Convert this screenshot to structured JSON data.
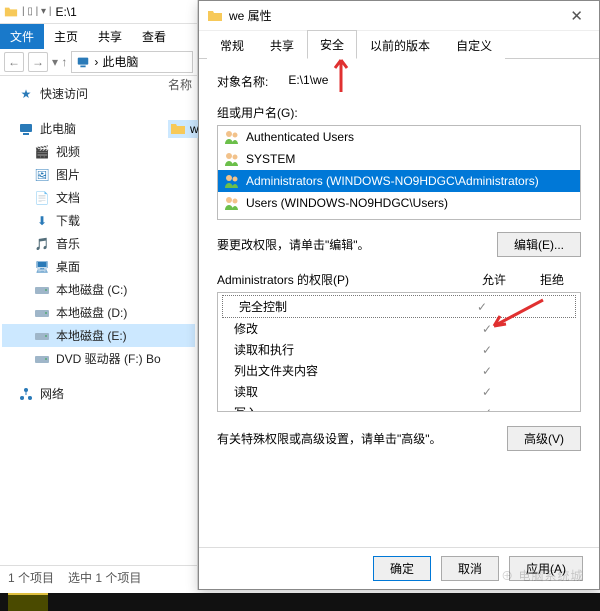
{
  "explorer": {
    "title_path": "E:\\1",
    "ribbon": {
      "file": "文件",
      "home": "主页",
      "share": "共享",
      "view": "查看"
    },
    "breadcrumb": "此电脑",
    "content_header": "名称",
    "file_row": "we",
    "tree": {
      "quick": "快速访问",
      "thispc": "此电脑",
      "items": [
        "视频",
        "图片",
        "文档",
        "下载",
        "音乐",
        "桌面"
      ],
      "drives": [
        "本地磁盘 (C:)",
        "本地磁盘 (D:)",
        "本地磁盘 (E:)",
        "DVD 驱动器 (F:) Bo"
      ],
      "selected_drive": 2,
      "network": "网络"
    },
    "status": {
      "count": "1 个项目",
      "selected": "选中 1 个项目"
    }
  },
  "dialog": {
    "title": "we 属性",
    "tabs": [
      "常规",
      "共享",
      "安全",
      "以前的版本",
      "自定义"
    ],
    "active_tab": 2,
    "object": {
      "label": "对象名称:",
      "value": "E:\\1\\we"
    },
    "group_label": "组或用户名(G):",
    "groups": [
      "Authenticated Users",
      "SYSTEM",
      "Administrators (WINDOWS-NO9HDGC\\Administrators)",
      "Users (WINDOWS-NO9HDGC\\Users)"
    ],
    "selected_group": 2,
    "edit_hint": "要更改权限，请单击\"编辑\"。",
    "edit_btn": "编辑(E)...",
    "perm_label": "Administrators 的权限(P)",
    "allow": "允许",
    "deny": "拒绝",
    "perms": [
      "完全控制",
      "修改",
      "读取和执行",
      "列出文件夹内容",
      "读取",
      "写入"
    ],
    "adv_hint": "有关特殊权限或高级设置，请单击\"高级\"。",
    "adv_btn": "高级(V)",
    "ok": "确定",
    "cancel": "取消",
    "apply": "应用(A)"
  },
  "watermark": "电脑系统城\nwww.dnxtc.net"
}
